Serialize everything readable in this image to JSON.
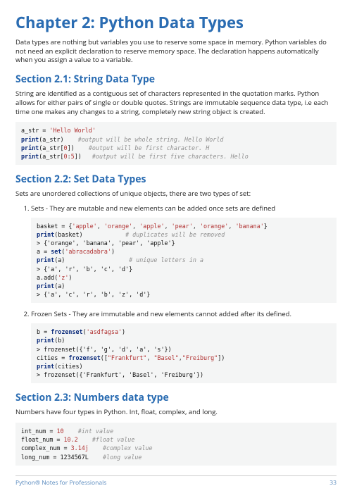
{
  "chapter_title": "Chapter 2: Python Data Types",
  "intro_para": "Data types are nothing but variables you use to reserve some space in memory. Python variables do not need an explicit declaration to reserve memory space. The declaration happens automatically when you assign a value to a variable.",
  "section21": {
    "title": "Section 2.1: String Data Type",
    "para": "String are identified as a contiguous set of characters represented in the quotation marks. Python allows for either pairs of single or double quotes. Strings are immutable sequence data type, i.e each time one makes any changes to a string, completely new string object is created.",
    "code": {
      "l1a": "a_str =",
      "l1b": "'Hello World'",
      "l2a": "print",
      "l2b": "(a_str)",
      "l2c": "#output will be whole string. Hello World",
      "l3a": "print",
      "l3b": "(a_str[",
      "l3c": "0",
      "l3d": "])",
      "l3e": "#output will be first character. H",
      "l4a": "print",
      "l4b": "(a_str[",
      "l4c": "0",
      "l4d": ":",
      "l4e": "5",
      "l4f": "])",
      "l4g": "#output will be first five characters. Hello"
    }
  },
  "section22": {
    "title": "Section 2.2: Set Data Types",
    "para": "Sets are unordered collections of unique objects, there are two types of set:",
    "item1_text": "Sets - They are mutable and new elements can be added once sets are defined",
    "code1": {
      "l1a": "basket = {",
      "l1b": "'apple'",
      "l1c": ",",
      "l1d": "'orange'",
      "l1e": ",",
      "l1f": "'apple'",
      "l1g": ",",
      "l1h": "'pear'",
      "l1i": ",",
      "l1j": "'orange'",
      "l1k": ",",
      "l1l": "'banana'",
      "l1m": "}",
      "l2a": "print",
      "l2b": "(basket)",
      "l2c": "# duplicates will be removed",
      "l3a": "> {'orange', 'banana', 'pear', 'apple'}",
      "l4a": "a =",
      "l4b": "set",
      "l4c": "(",
      "l4d": "'abracadabra'",
      "l4e": ")",
      "l5a": "print",
      "l5b": "(a)",
      "l5c": "# unique letters in a",
      "l6a": "> {'a', 'r', 'b', 'c', 'd'}",
      "l7a": "a.add(",
      "l7b": "'z'",
      "l7c": ")",
      "l8a": "print",
      "l8b": "(a)",
      "l9a": "> {'a', 'c', 'r', 'b', 'z', 'd'}"
    },
    "item2_text": "Frozen Sets - They are immutable and new elements cannot added after its defined.",
    "code2": {
      "l1a": "b =",
      "l1b": "frozenset",
      "l1c": "(",
      "l1d": "'asdfagsa'",
      "l1e": ")",
      "l2a": "print",
      "l2b": "(b)",
      "l3a": "> frozenset({'f', 'g', 'd', 'a', 's'})",
      "l4a": "cities =",
      "l4b": "frozenset",
      "l4c": "([",
      "l4d": "\"Frankfurt\"",
      "l4e": ",",
      "l4f": "\"Basel\"",
      "l4g": ",",
      "l4h": "\"Freiburg\"",
      "l4i": "])",
      "l5a": "print",
      "l5b": "(cities)",
      "l6a": "> frozenset({'Frankfurt', 'Basel', 'Freiburg'})"
    }
  },
  "section23": {
    "title": "Section 2.3: Numbers data type",
    "para": "Numbers have four types in Python. Int, float, complex, and long.",
    "code": {
      "l1a": "int_num =",
      "l1b": "10",
      "l1c": "#int value",
      "l2a": "float_num =",
      "l2b": "10.2",
      "l2c": "#float value",
      "l3a": "complex_num =",
      "l3b": "3.14j",
      "l3c": "#complex value",
      "l4a": "long_num =",
      "l4b": "1234567L",
      "l4c": "#long value"
    }
  },
  "footer": {
    "left": "Python® Notes for Professionals",
    "right": "33"
  }
}
